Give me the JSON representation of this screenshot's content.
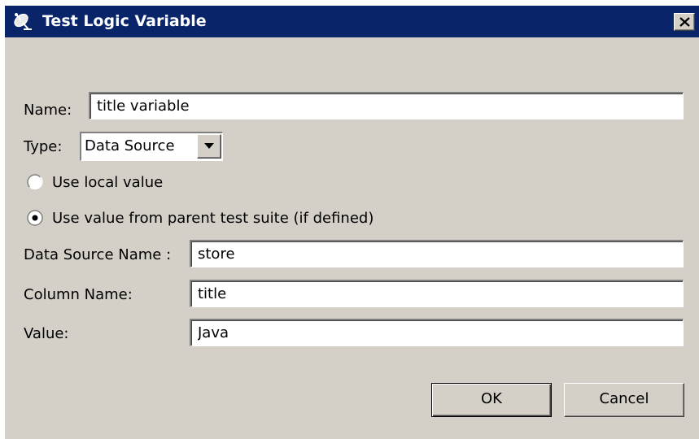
{
  "window": {
    "title": "Test Logic Variable",
    "title_icon": "satellite-dish-icon",
    "close_icon": "close-x-icon"
  },
  "form": {
    "name_label": "Name:",
    "name_value": "title variable",
    "type_label": "Type:",
    "type_selected": "Data Source",
    "radio_local_label": "Use local value",
    "radio_local_checked": false,
    "radio_parent_label": "Use value from parent test suite (if defined)",
    "radio_parent_checked": true,
    "datasource_label": "Data Source Name :",
    "datasource_value": "store",
    "column_label": "Column Name:",
    "column_value": "title",
    "value_label": "Value:",
    "value_value": "Java"
  },
  "buttons": {
    "ok_label": "OK",
    "cancel_label": "Cancel"
  },
  "colors": {
    "titlebar": "#0a246a",
    "dialog_bg": "#d4d0c8"
  }
}
